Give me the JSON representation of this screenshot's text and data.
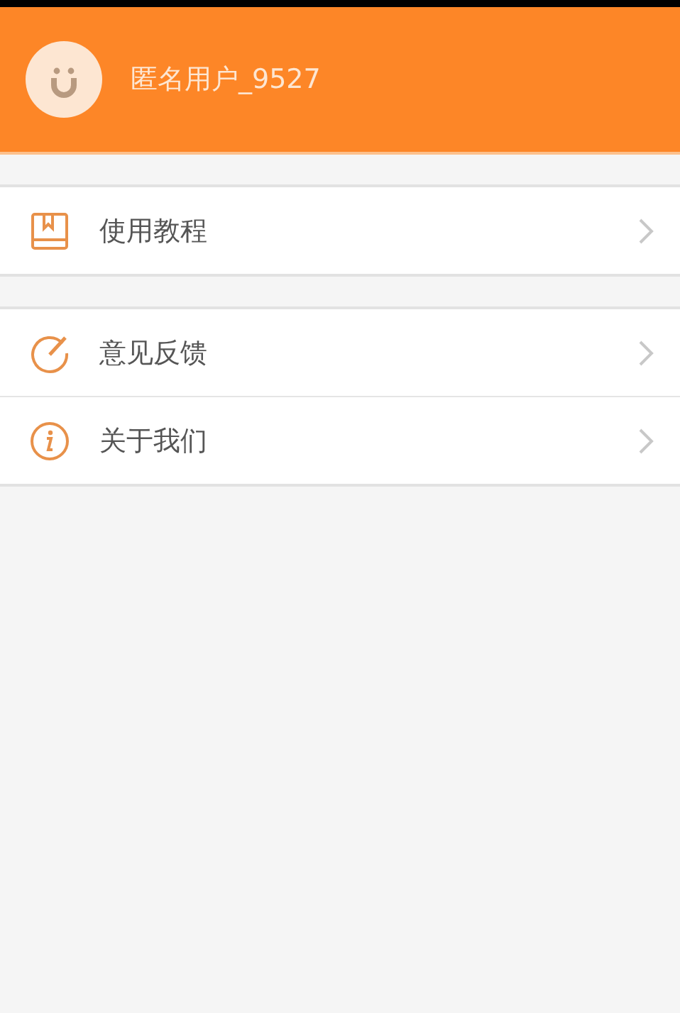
{
  "header": {
    "username": "匿名用户_9527"
  },
  "groups": [
    {
      "items": [
        {
          "kind": "book",
          "label": "使用教程"
        }
      ]
    },
    {
      "items": [
        {
          "kind": "feedback",
          "label": "意见反馈"
        },
        {
          "kind": "info",
          "label": "关于我们"
        }
      ]
    }
  ]
}
